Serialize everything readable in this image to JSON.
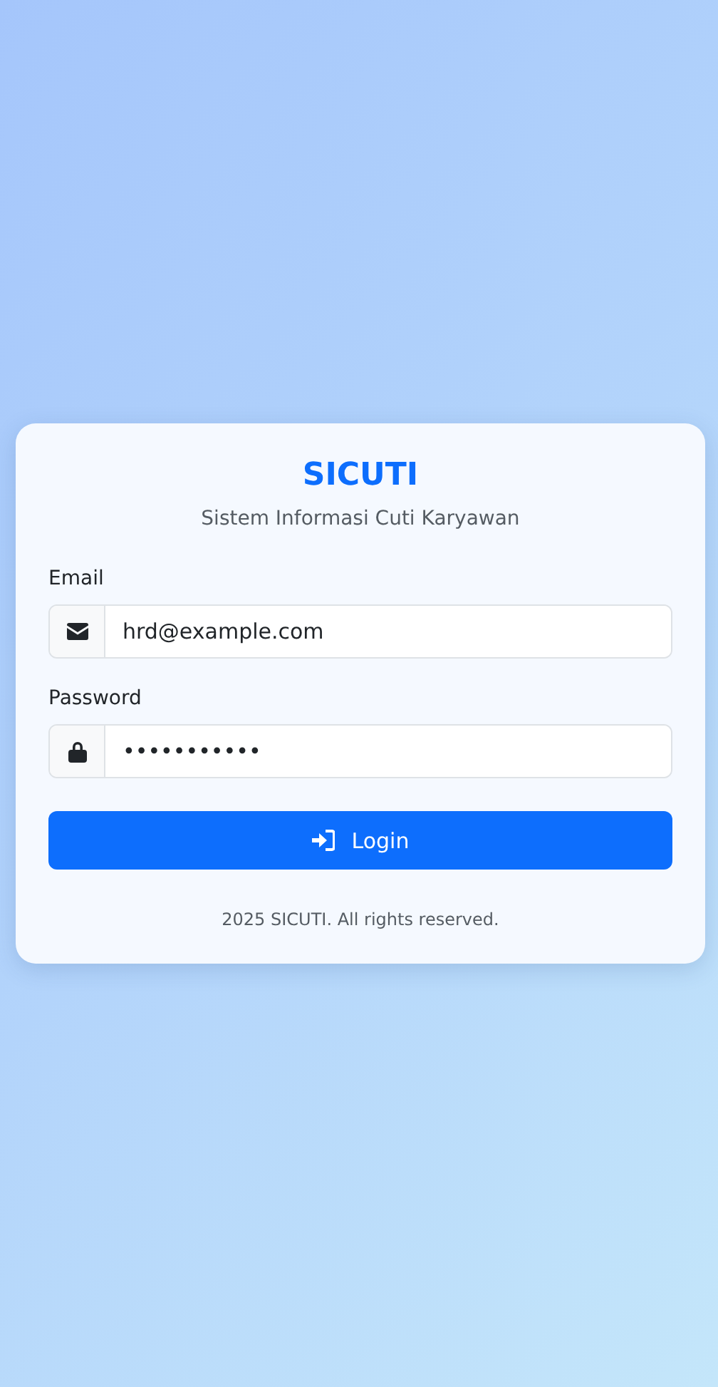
{
  "title": "SICUTI",
  "subtitle": "Sistem Informasi Cuti Karyawan",
  "fields": [
    {
      "kind": "email",
      "label": "Email",
      "value": "hrd@example.com"
    },
    {
      "kind": "password",
      "label": "Password",
      "value": "•••••••••••"
    }
  ],
  "button": {
    "label": "Login"
  },
  "footer": "2025 SICUTI. All rights reserved."
}
